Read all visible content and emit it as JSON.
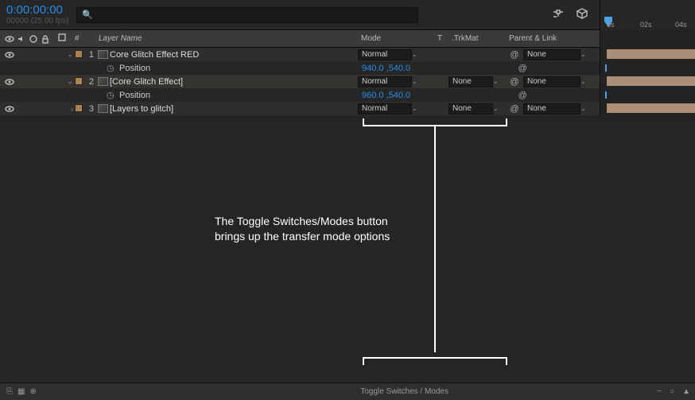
{
  "header": {
    "timecode": "0:00:00:00",
    "frame_info": "00000 (25.00 fps)",
    "search_placeholder": ""
  },
  "columns": {
    "num_hash": "#",
    "layer_name": "Layer Name",
    "mode": "Mode",
    "t": "T",
    "trkmat": ".TrkMat",
    "parent": "Parent & Link"
  },
  "layers": [
    {
      "twirl": "open",
      "num": "1",
      "name": "Core Glitch Effect RED",
      "mode": "Normal",
      "trkmat": "",
      "parent": "None",
      "props": [
        {
          "name": "Position",
          "value": "940.0 ,540.0"
        }
      ]
    },
    {
      "twirl": "open",
      "num": "2",
      "name": "[Core Glitch Effect]",
      "mode": "Normal",
      "trkmat": "None",
      "parent": "None",
      "props": [
        {
          "name": "Position",
          "value": "960.0 ,540.0"
        }
      ]
    },
    {
      "twirl": "closed",
      "num": "3",
      "name": "[Layers to glitch]",
      "mode": "Normal",
      "trkmat": "None",
      "parent": "None",
      "props": []
    }
  ],
  "annotation": {
    "line1": "The Toggle Switches/Modes button",
    "line2": "brings up the transfer mode options"
  },
  "footer": {
    "toggle_label": "Toggle Switches / Modes"
  },
  "timeline": {
    "ticks": [
      "0s",
      "02s",
      "04s"
    ]
  }
}
